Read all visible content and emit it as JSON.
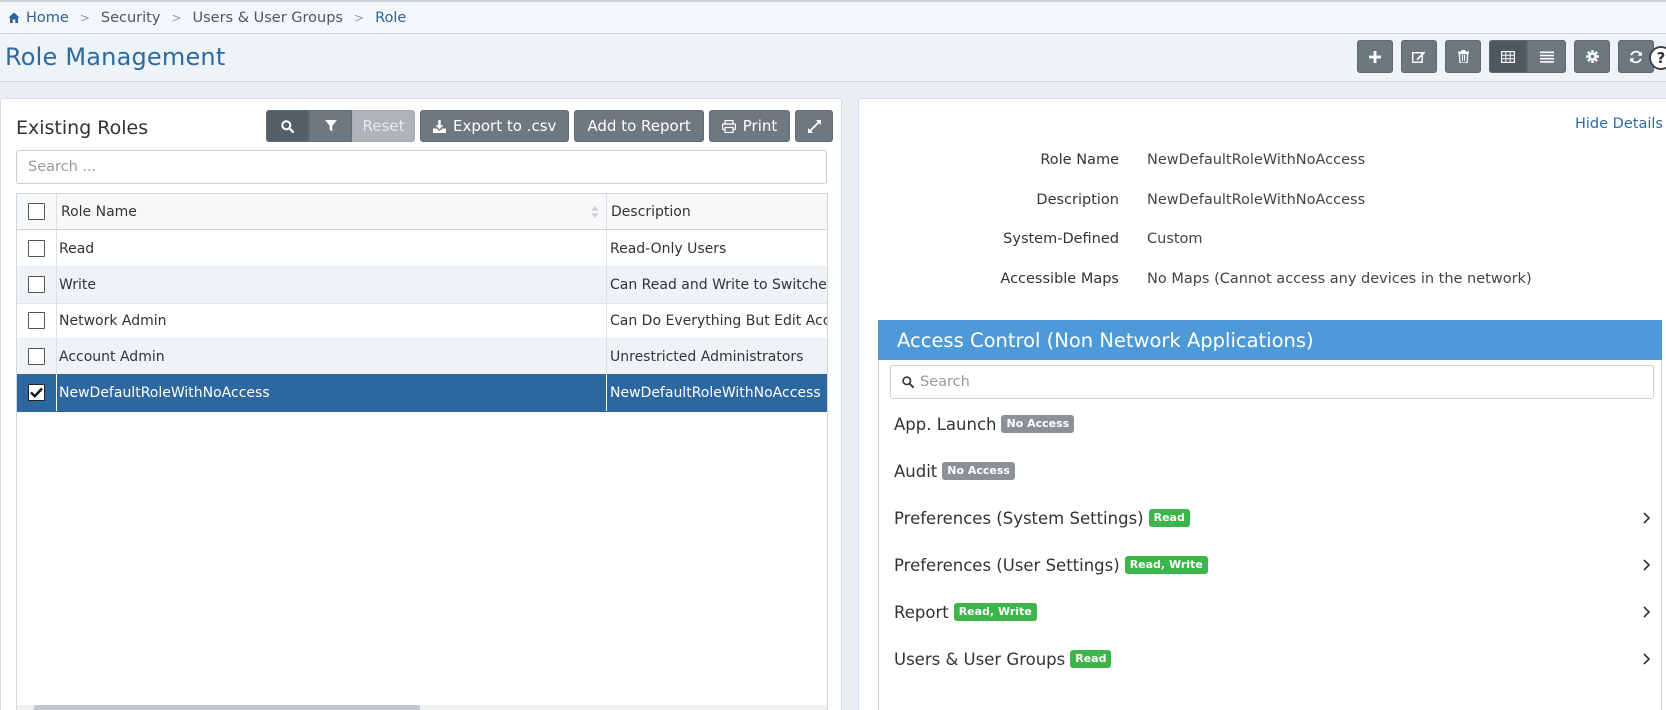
{
  "breadcrumb": {
    "items": [
      {
        "label": "Home"
      },
      {
        "label": "Security"
      },
      {
        "label": "Users & User Groups"
      },
      {
        "label": "Role"
      }
    ],
    "separator": ">"
  },
  "header": {
    "title": "Role Management",
    "toolbar_icons": [
      "plus-icon",
      "edit-icon",
      "trash-icon",
      "grid-view-icon",
      "list-view-icon",
      "gear-icon",
      "refresh-icon",
      "help-icon"
    ],
    "help_label": "?"
  },
  "roles_panel": {
    "title": "Existing Roles",
    "reset_label": "Reset",
    "export_label": "Export to .csv",
    "add_to_report_label": "Add to Report",
    "print_label": "Print",
    "search_placeholder": "Search ...",
    "columns": [
      "Role Name",
      "Description"
    ],
    "rows": [
      {
        "name": "Read",
        "description": "Read-Only Users",
        "checked": false
      },
      {
        "name": "Write",
        "description": "Can Read and Write to Switches",
        "checked": false
      },
      {
        "name": "Network Admin",
        "description": "Can Do Everything But Edit Accounts",
        "checked": false
      },
      {
        "name": "Account Admin",
        "description": "Unrestricted Administrators",
        "checked": false
      },
      {
        "name": "NewDefaultRoleWithNoAccess",
        "description": "NewDefaultRoleWithNoAccess",
        "checked": true
      }
    ]
  },
  "details_panel": {
    "hide_details_label": "Hide Details",
    "fields": [
      {
        "label": "Role Name",
        "value": "NewDefaultRoleWithNoAccess"
      },
      {
        "label": "Description",
        "value": "NewDefaultRoleWithNoAccess"
      },
      {
        "label": "System-Defined",
        "value": "Custom"
      },
      {
        "label": "Accessible Maps",
        "value": "No Maps (Cannot access any devices in the network)"
      }
    ],
    "access_control": {
      "title": "Access Control (Non Network Applications)",
      "search_placeholder": "Search",
      "items": [
        {
          "name": "App. Launch",
          "badge": "No Access",
          "expandable": false
        },
        {
          "name": "Audit",
          "badge": "No Access",
          "expandable": false
        },
        {
          "name": "Preferences (System Settings)",
          "badge": "Read",
          "expandable": true
        },
        {
          "name": "Preferences (User Settings)",
          "badge": "Read, Write",
          "expandable": true
        },
        {
          "name": "Report",
          "badge": "Read, Write",
          "expandable": true
        },
        {
          "name": "Users & User Groups",
          "badge": "Read",
          "expandable": true
        }
      ]
    }
  },
  "colors": {
    "accent": "#2d6a9f",
    "selected_row": "#2c67a0",
    "section_header": "#4e9ad9",
    "badge_no_access": "#8c9196",
    "badge_permission": "#3cb54a"
  }
}
